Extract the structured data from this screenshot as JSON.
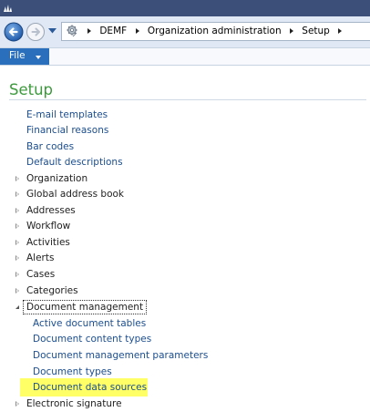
{
  "nav": {
    "breadcrumbs": [
      "DEMF",
      "Organization administration",
      "Setup"
    ]
  },
  "ribbon": {
    "file_label": "File"
  },
  "page": {
    "title": "Setup"
  },
  "tree": {
    "top_links": [
      "E-mail templates",
      "Financial reasons",
      "Bar codes",
      "Default descriptions"
    ],
    "categories_before": [
      "Organization",
      "Global address book",
      "Addresses",
      "Workflow",
      "Activities",
      "Alerts",
      "Cases",
      "Categories"
    ],
    "expanded": {
      "label": "Document management",
      "children": [
        "Active document tables",
        "Document content types",
        "Document management parameters",
        "Document types",
        "Document data sources"
      ]
    },
    "categories_after": [
      "Electronic signature"
    ]
  },
  "colors": {
    "title_green": "#3c9a3c",
    "link_blue": "#1b4e8f",
    "file_tab_blue": "#2a6fbc",
    "highlight_yellow": "#ffff66"
  },
  "icons": {
    "app": "dynamics-logo-icon",
    "back": "back-arrow-icon",
    "forward": "forward-arrow-icon",
    "history": "history-dropdown-icon",
    "area": "gear-icon",
    "expander": "expand-triangle-icon",
    "collapser": "collapse-triangle-icon"
  }
}
